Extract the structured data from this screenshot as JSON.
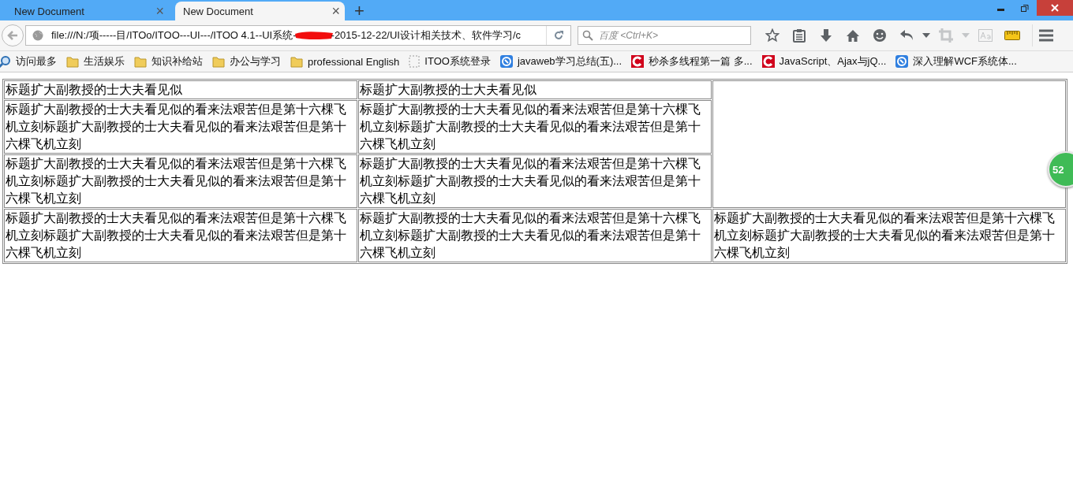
{
  "tabs": [
    {
      "label": "New Document",
      "selected": false,
      "close": "×"
    },
    {
      "label": "New Document",
      "selected": true,
      "close": "×"
    }
  ],
  "new_tab": "+",
  "address_bar": {
    "url_start": "file:///N:/项-----目/ITOo/ITOO---UI---/ITOO 4.1--UI系统-",
    "url_end": "-2015-12-22/UI设计相关技术、软件学习/c"
  },
  "search": {
    "placeholder": "百度 <Ctrl+K>"
  },
  "toolbar": [
    {
      "kind": "star",
      "disabled": false
    },
    {
      "kind": "reading-list",
      "disabled": false
    },
    {
      "kind": "download",
      "disabled": false
    },
    {
      "kind": "home",
      "disabled": false
    },
    {
      "kind": "smiley",
      "disabled": false
    },
    {
      "kind": "undo",
      "disabled": false
    },
    {
      "kind": "caret",
      "disabled": false
    },
    {
      "kind": "crop",
      "disabled": true
    },
    {
      "kind": "caret",
      "disabled": true
    },
    {
      "kind": "font",
      "disabled": true
    },
    {
      "kind": "ruler",
      "disabled": false
    },
    {
      "kind": "menu",
      "disabled": false
    }
  ],
  "bookmarks": [
    {
      "kind": "history",
      "label": "访问最多"
    },
    {
      "kind": "folder",
      "label": "生活娱乐"
    },
    {
      "kind": "folder",
      "label": "知识补给站"
    },
    {
      "kind": "folder",
      "label": "办公与学习"
    },
    {
      "kind": "folder",
      "label": "professional English"
    },
    {
      "kind": "blank",
      "label": "ITOO系统登录"
    },
    {
      "kind": "blue-site",
      "label": "javaweb学习总结(五)..."
    },
    {
      "kind": "red-site",
      "label": "秒杀多线程第一篇 多..."
    },
    {
      "kind": "red-site",
      "label": "JavaScript、Ajax与jQ..."
    },
    {
      "kind": "blue-site",
      "label": "深入理解WCF系统体..."
    }
  ],
  "table": {
    "rows": [
      {
        "cells": [
          {
            "kind": "text",
            "text": "标题扩大副教授的士大夫看见似"
          },
          {
            "kind": "text",
            "text": "标题扩大副教授的士大夫看见似"
          },
          {
            "kind": "blank"
          }
        ]
      },
      {
        "cells": [
          {
            "kind": "text",
            "text": "标题扩大副教授的士大夫看见似的看来法艰苦但是第十六棵飞机立刻标题扩大副教授的士大夫看见似的看来法艰苦但是第十六棵飞机立刻"
          },
          {
            "kind": "text",
            "text": "标题扩大副教授的士大夫看见似的看来法艰苦但是第十六棵飞机立刻标题扩大副教授的士大夫看见似的看来法艰苦但是第十六棵飞机立刻"
          }
        ]
      },
      {
        "cells": [
          {
            "kind": "text",
            "text": "标题扩大副教授的士大夫看见似的看来法艰苦但是第十六棵飞机立刻标题扩大副教授的士大夫看见似的看来法艰苦但是第十六棵飞机立刻"
          },
          {
            "kind": "text",
            "text": "标题扩大副教授的士大夫看见似的看来法艰苦但是第十六棵飞机立刻标题扩大副教授的士大夫看见似的看来法艰苦但是第十六棵飞机立刻"
          }
        ]
      },
      {
        "cells": [
          {
            "kind": "text",
            "text": "标题扩大副教授的士大夫看见似的看来法艰苦但是第十六棵飞机立刻标题扩大副教授的士大夫看见似的看来法艰苦但是第十六棵飞机立刻"
          },
          {
            "kind": "text",
            "text": "标题扩大副教授的士大夫看见似的看来法艰苦但是第十六棵飞机立刻标题扩大副教授的士大夫看见似的看来法艰苦但是第十六棵飞机立刻"
          },
          {
            "kind": "text",
            "text": "标题扩大副教授的士大夫看见似的看来法艰苦但是第十六棵飞机立刻标题扩大副教授的士大夫看见似的看来法艰苦但是第十六棵飞机立刻"
          }
        ]
      }
    ]
  },
  "speed_badge": "52"
}
